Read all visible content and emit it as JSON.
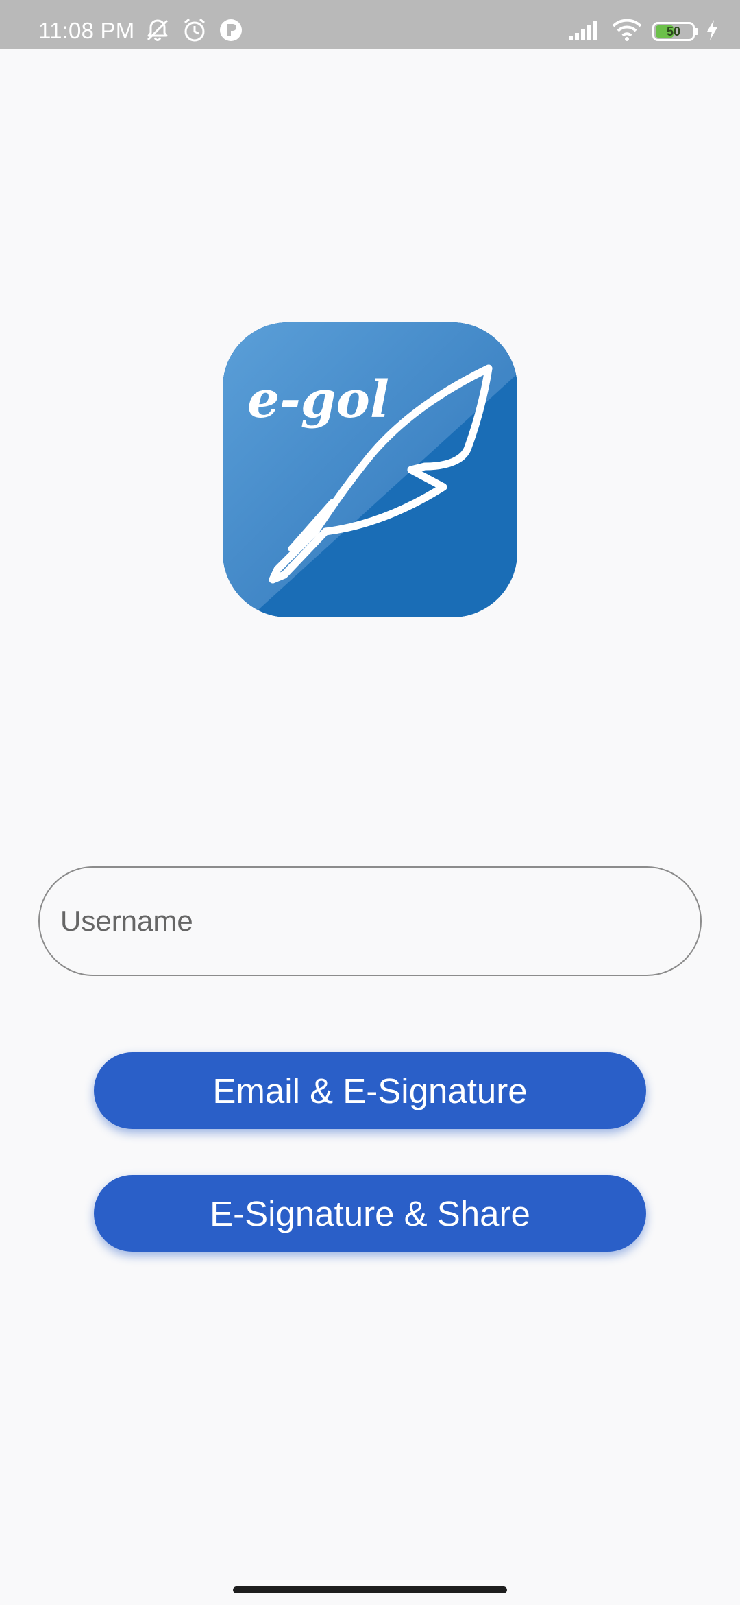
{
  "status_bar": {
    "time": "11:08 PM",
    "battery_level": "50",
    "battery_fraction": 0.5,
    "left_icons": [
      "notifications-muted-icon",
      "alarm-icon",
      "app-notification-icon"
    ],
    "right_icons": [
      "cellular-signal-icon",
      "wifi-icon",
      "battery-icon",
      "charging-bolt-icon"
    ]
  },
  "logo": {
    "text": "e-gol",
    "icon": "quill-feather-icon"
  },
  "login_form": {
    "username_placeholder": "Username",
    "username_value": ""
  },
  "actions": {
    "email_signature_label": "Email & E-Signature",
    "signature_share_label": "E-Signature & Share"
  },
  "colors": {
    "background": "#f9f9fa",
    "status_bar": "#b9b9b9",
    "button": "#2a5fc8",
    "logo_blue": "#1a6db6",
    "battery_fill": "#6cc04a"
  }
}
